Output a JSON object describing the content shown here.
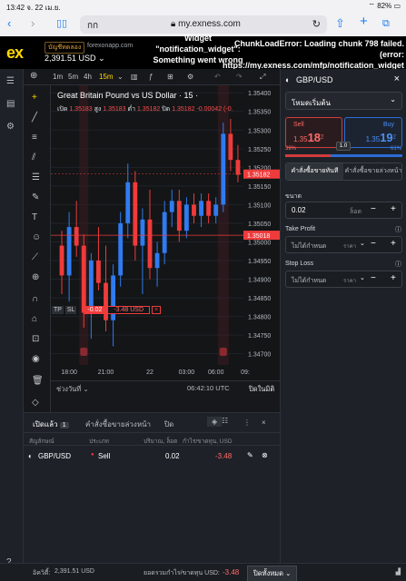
{
  "status_bar": {
    "time": "13:42",
    "date": "จ. 22 เม.ย.",
    "battery": "82%"
  },
  "browser": {
    "aa_label": "กก",
    "url": "my.exness.com"
  },
  "header": {
    "logo": "ex",
    "account_type": "บัญชีทดลอง",
    "server": "forexonapp.com",
    "balance": "2,391.51 USD",
    "error_widget": "Widget \"notification_widget\": Something went wrong",
    "error_chunk": "ChunkLoadError: Loading chunk 798 failed. (error: https://my.exness.com/mfp/notification_widget/...) [object Object]"
  },
  "chart_toolbar": {
    "timeframes": [
      "1m",
      "5m",
      "4h",
      "15m"
    ],
    "active_timeframe": "15m"
  },
  "chart": {
    "title": "Great Britain Pound vs US Dollar · 15 ·",
    "ohlc_open_label": "เปิด",
    "ohlc_open": "1.35183",
    "ohlc_high_label": "สูง",
    "ohlc_high": "1.35183",
    "ohlc_low_label": "ต่ำ",
    "ohlc_low": "1.35182",
    "ohlc_close_label": "ปิด",
    "ohlc_close": "1.35182",
    "ohlc_change": "-0.00042 (-0.",
    "position_line": {
      "tp": "TP",
      "sl": "SL",
      "lot": "-0.02",
      "pnl": "-3.48 USD",
      "close": "×"
    },
    "current_price": "1.35182",
    "position_price": "1.35018",
    "time_range_label": "ช่วงวันที่",
    "clock": "06:42:10 UTC",
    "market_status": "ปิดในมิติ"
  },
  "chart_data": {
    "type": "candlestick",
    "y_ticks": [
      "1.35400",
      "1.35350",
      "1.35300",
      "1.35250",
      "1.35200",
      "1.35150",
      "1.35100",
      "1.35050",
      "1.35000",
      "1.34950",
      "1.34900",
      "1.34850",
      "1.34800",
      "1.34750",
      "1.34700"
    ],
    "x_ticks": [
      "18:00",
      "21:00",
      "22",
      "03:00",
      "06:00",
      "09:"
    ],
    "ylim": [
      1.3467,
      1.3542
    ],
    "candles": [
      {
        "o": 1.3499,
        "h": 1.3503,
        "l": 1.3486,
        "c": 1.3491
      },
      {
        "o": 1.3491,
        "h": 1.3508,
        "l": 1.3484,
        "c": 1.3504
      },
      {
        "o": 1.3504,
        "h": 1.3511,
        "l": 1.3496,
        "c": 1.3499
      },
      {
        "o": 1.3499,
        "h": 1.3502,
        "l": 1.3477,
        "c": 1.3481
      },
      {
        "o": 1.3481,
        "h": 1.3497,
        "l": 1.3474,
        "c": 1.3495
      },
      {
        "o": 1.3495,
        "h": 1.3504,
        "l": 1.3487,
        "c": 1.3489
      },
      {
        "o": 1.3489,
        "h": 1.3499,
        "l": 1.3476,
        "c": 1.3479
      },
      {
        "o": 1.3479,
        "h": 1.3494,
        "l": 1.3472,
        "c": 1.3491
      },
      {
        "o": 1.3491,
        "h": 1.3508,
        "l": 1.3488,
        "c": 1.3505
      },
      {
        "o": 1.3505,
        "h": 1.3521,
        "l": 1.3501,
        "c": 1.3516
      },
      {
        "o": 1.3516,
        "h": 1.3519,
        "l": 1.3495,
        "c": 1.3499
      },
      {
        "o": 1.3499,
        "h": 1.3509,
        "l": 1.3486,
        "c": 1.3506
      },
      {
        "o": 1.3506,
        "h": 1.3514,
        "l": 1.349,
        "c": 1.3493
      },
      {
        "o": 1.3493,
        "h": 1.35,
        "l": 1.3488,
        "c": 1.3497
      },
      {
        "o": 1.3497,
        "h": 1.3511,
        "l": 1.3494,
        "c": 1.3508
      },
      {
        "o": 1.3508,
        "h": 1.3514,
        "l": 1.3504,
        "c": 1.3511
      },
      {
        "o": 1.3511,
        "h": 1.3514,
        "l": 1.35,
        "c": 1.3503
      },
      {
        "o": 1.3503,
        "h": 1.3512,
        "l": 1.3501,
        "c": 1.351
      },
      {
        "o": 1.351,
        "h": 1.3513,
        "l": 1.3505,
        "c": 1.3507
      },
      {
        "o": 1.3507,
        "h": 1.3513,
        "l": 1.3504,
        "c": 1.3511
      },
      {
        "o": 1.3511,
        "h": 1.3513,
        "l": 1.3505,
        "c": 1.3507
      },
      {
        "o": 1.3507,
        "h": 1.3512,
        "l": 1.3505,
        "c": 1.351
      },
      {
        "o": 1.351,
        "h": 1.3532,
        "l": 1.3508,
        "c": 1.3529
      },
      {
        "o": 1.3529,
        "h": 1.3533,
        "l": 1.3519,
        "c": 1.3522
      },
      {
        "o": 1.3522,
        "h": 1.3526,
        "l": 1.3516,
        "c": 1.3518
      }
    ],
    "session_markers": [
      "06:00",
      "03:00"
    ]
  },
  "order_panel": {
    "symbol": "GBP/USD",
    "mode": "โหมดเริ่มต้น",
    "sell_label": "Sell",
    "sell_price_main": "1.35",
    "sell_price_big": "18",
    "sell_price_sup": "2",
    "buy_label": "Buy",
    "buy_price_main": "1.35",
    "buy_price_big": "19",
    "buy_price_sup": "2",
    "spread": "1.0",
    "sentiment_sell": "39%",
    "sentiment_buy": "61%",
    "sentiment_sell_fraction": 0.39,
    "order_type_market": "คำสั่งซื้อขายทันที",
    "order_type_pending": "คำสั่งซื้อขายล่วงหน้า",
    "volume_label": "ขนาด",
    "volume_value": "0.02",
    "volume_unit": "ล็อต",
    "take_profit_label": "Take Profit",
    "take_profit_value": "ไม่ได้กำหนด",
    "take_profit_unit": "ราคา",
    "stop_loss_label": "Stop Loss",
    "stop_loss_value": "ไม่ได้กำหนด",
    "stop_loss_unit": "ราคา"
  },
  "positions": {
    "tab_open": "เปิดแล้ว",
    "tab_open_count": "1",
    "tab_pending": "คำสั่งซื้อขายล่วงหน้า",
    "tab_closed": "ปิด",
    "col_symbol": "สัญลักษณ์",
    "col_type": "ประเภท",
    "col_volume": "ปริมาณ, ล็อต",
    "col_pnl": "กำไร/ขาดทุน, USD",
    "rows": [
      {
        "symbol": "GBP/USD",
        "type": "Sell",
        "volume": "0.02",
        "pnl": "-3.48"
      }
    ]
  },
  "footer": {
    "equity_label": "อิควิตี้:",
    "equity_value": "2,391.51 USD",
    "total_pnl_label": "ยอดรวมกำไร/ขาดทุน USD:",
    "total_pnl_value": "-3.48",
    "close_all": "ปิดทั้งหมด"
  },
  "colors": {
    "bull": "#2f7bf1",
    "bear": "#ef3b3b",
    "background": "#131517",
    "accent_yellow": "#ffd900"
  }
}
